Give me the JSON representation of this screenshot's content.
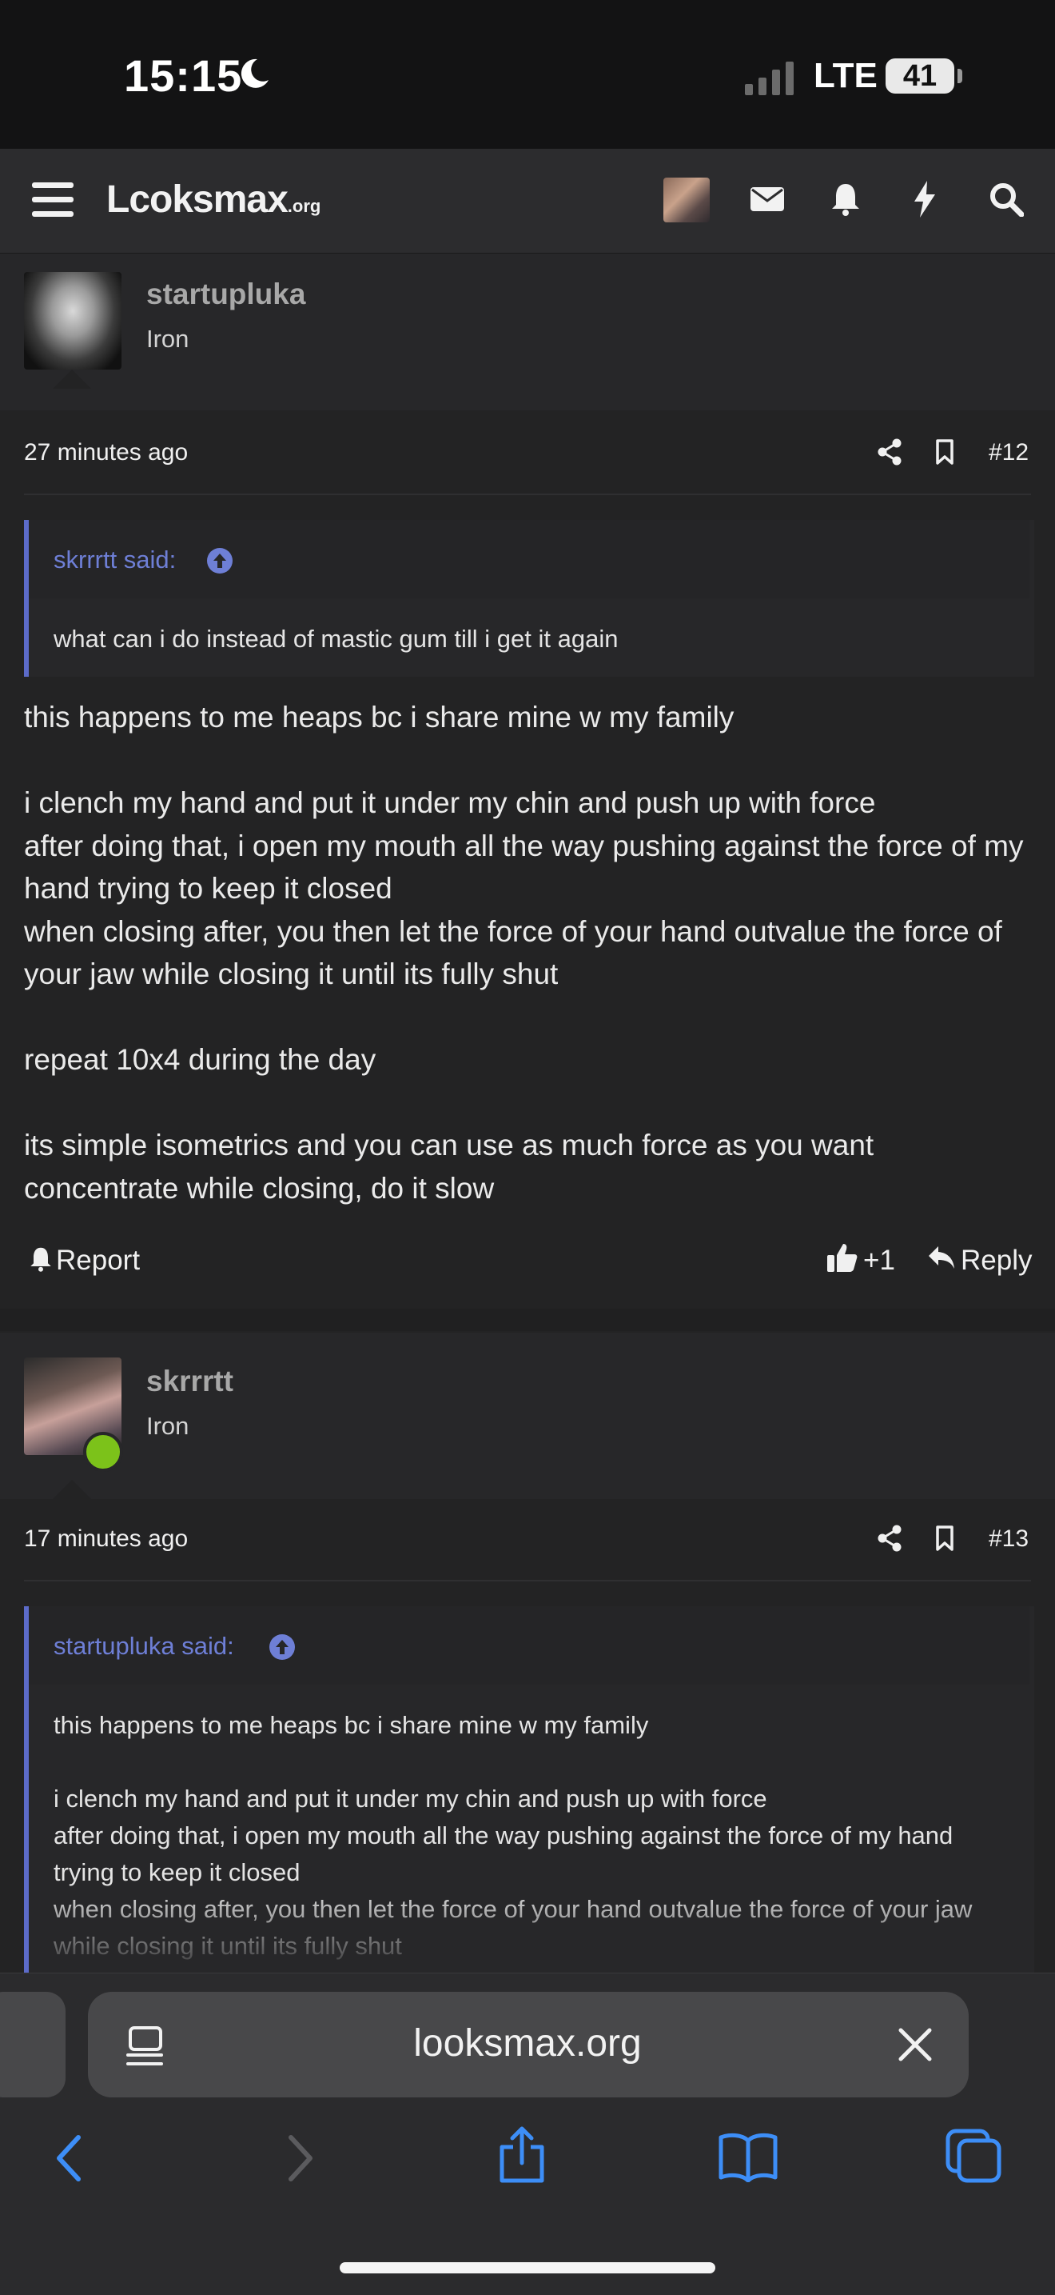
{
  "status": {
    "time": "15:15",
    "network": "LTE",
    "battery": "41"
  },
  "nav": {
    "logo_main": "Lcoksmax",
    "logo_suffix": ".org"
  },
  "posts": [
    {
      "username": "startupluka",
      "rank": "Iron",
      "time": "27 minutes ago",
      "number": "#12",
      "quote_author": "skrrrtt said:",
      "quote_text": "what can i do instead of mastic gum till i get it again",
      "body": "this happens to me heaps bc i share mine w my family\n\ni clench my hand and put it under my chin and push up with force\nafter doing that, i open my mouth all the way pushing against the force of my hand trying to keep it closed\nwhen closing after, you then let the force of your hand outvalue the force of your jaw while closing it until its fully shut\n\nrepeat 10x4 during the day\n\nits simple isometrics and you can use as much force as you want\nconcentrate while closing, do it slow",
      "report_label": "Report",
      "reaction_count": "+1",
      "reply_label": "Reply"
    },
    {
      "username": "skrrrtt",
      "rank": "Iron",
      "time": "17 minutes ago",
      "number": "#13",
      "quote_author": "startupluka said:",
      "quote_text": "this happens to me heaps bc i share mine w my family\n\ni clench my hand and put it under my chin and push up with force\nafter doing that, i open my mouth all the way pushing against the force of my hand trying to keep it closed\nwhen closing after, you then let the force of your hand outvalue the force of your jaw while closing it until its fully shut"
    }
  ],
  "browser": {
    "url": "looksmax.org"
  },
  "colors": {
    "accent": "#5c6bc9",
    "link": "#6e7fd6",
    "online": "#7cc21a",
    "browser_blue": "#3d8ef7"
  },
  "icons": [
    "menu-icon",
    "mail-icon",
    "bell-icon",
    "lightning-icon",
    "search-icon",
    "share-icon",
    "bookmark-icon",
    "arrow-up-circle-icon",
    "bell-icon",
    "thumbs-up-icon",
    "reply-icon",
    "reader-icon",
    "close-icon",
    "back-icon",
    "forward-icon",
    "share-sheet-icon",
    "bookmarks-icon",
    "tabs-icon"
  ]
}
